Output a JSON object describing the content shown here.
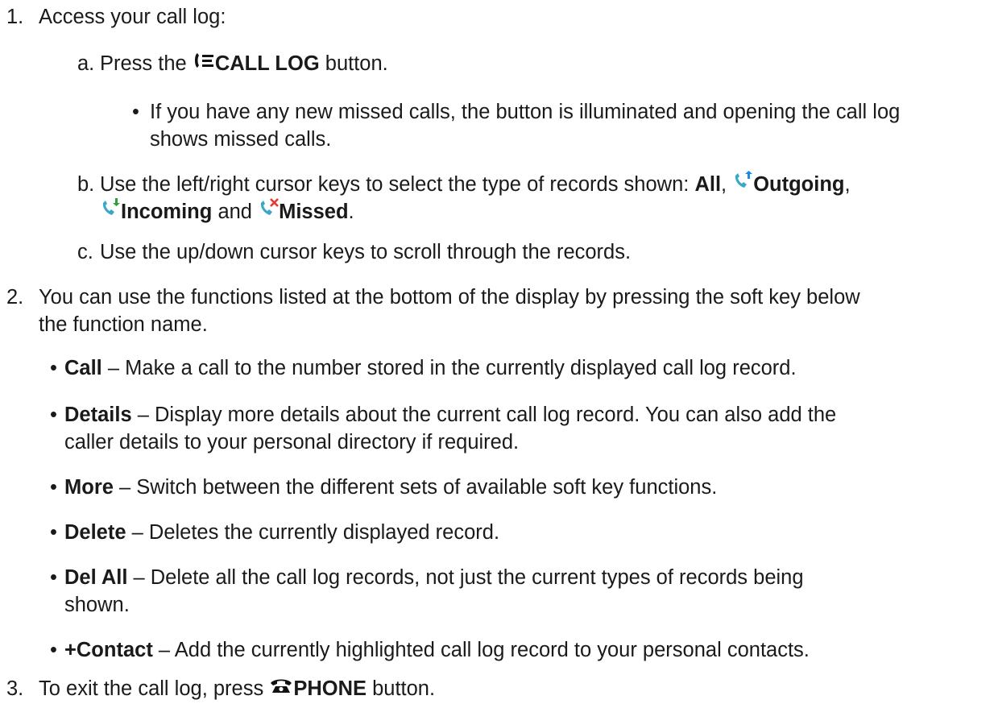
{
  "steps": [
    {
      "number": "1.",
      "text": "Access your call log:"
    },
    {
      "number": "2.",
      "line1": "You can use the functions listed at the bottom of the display by pressing the soft key below",
      "line2": "the function name."
    },
    {
      "number": "3.",
      "pre": "To exit the call log, press",
      "button": "PHONE",
      "post": "button."
    }
  ],
  "substeps": {
    "a": {
      "letter": "a.",
      "pre": "Press the",
      "button": "CALL LOG",
      "post": "button."
    },
    "a_note": {
      "line1": "If you have any new missed calls, the button is illuminated and opening the call log",
      "line2": "shows missed calls."
    },
    "b": {
      "letter": "b.",
      "pre": "Use the left/right cursor keys to select the type of records shown:",
      "all": "All",
      "outgoing": "Outgoing",
      "incoming": "Incoming",
      "and": "and",
      "missed": "Missed"
    },
    "c": {
      "letter": "c.",
      "text": "Use the up/down cursor keys to scroll through the records."
    }
  },
  "functions": [
    {
      "name": "Call",
      "line1": "– Make a call to the number stored in the currently displayed call log record."
    },
    {
      "name": "Details",
      "line1": "– Display more details about the current call log record. You can also add the",
      "line2": "caller details to your personal directory if required."
    },
    {
      "name": "More",
      "line1": "– Switch between the different sets of available soft key functions."
    },
    {
      "name": "Delete",
      "line1": "– Deletes the currently displayed record."
    },
    {
      "name": "Del All",
      "line1": "– Delete all the call log records, not just the current types of records being",
      "line2": "shown."
    },
    {
      "name": "+Contact",
      "line1": "– Add the currently highlighted call log record to your personal contacts."
    }
  ],
  "icons": {
    "call_log": "call-log-icon",
    "outgoing": "outgoing-call-icon",
    "incoming": "incoming-call-icon",
    "missed": "missed-call-icon",
    "phone": "phone-icon"
  },
  "colors": {
    "text": "#1a1a1a",
    "outgoing_arrow": "#1e88e5",
    "incoming_arrow": "#2e9e3e",
    "missed_x": "#e53935",
    "handset": "#3aa7c9"
  }
}
